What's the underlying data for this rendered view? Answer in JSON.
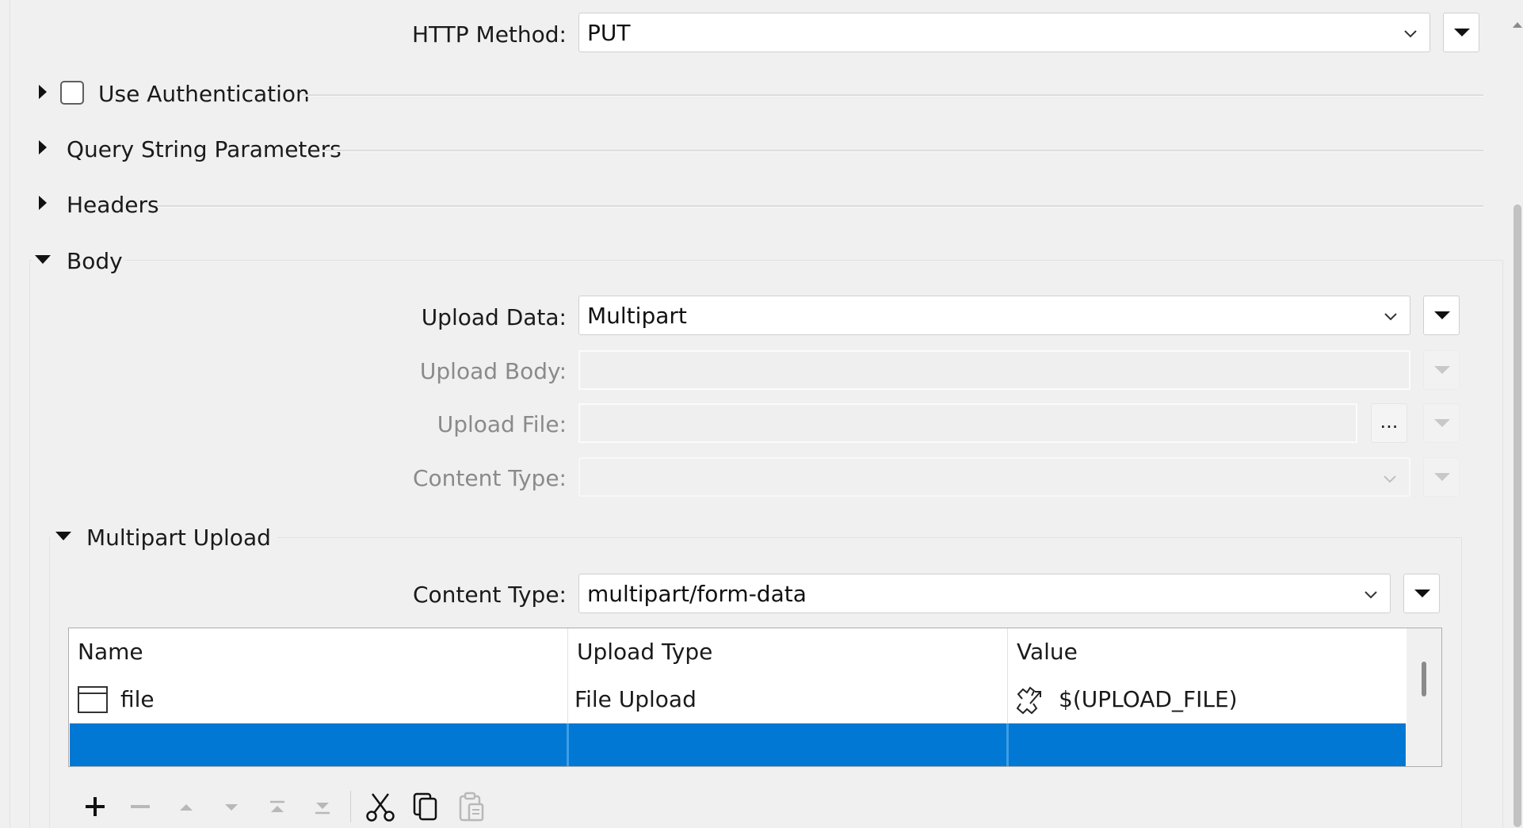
{
  "http_method": {
    "label": "HTTP Method:",
    "value": "PUT"
  },
  "sections": {
    "use_authentication": {
      "label": "Use Authentication",
      "checked": false
    },
    "query_string": {
      "label": "Query String Parameters"
    },
    "headers": {
      "label": "Headers"
    },
    "body": {
      "label": "Body"
    }
  },
  "body": {
    "upload_data": {
      "label": "Upload Data:",
      "value": "Multipart"
    },
    "upload_body": {
      "label": "Upload Body:",
      "value": ""
    },
    "upload_file": {
      "label": "Upload File:",
      "value": "",
      "browse_label": "..."
    },
    "content_type": {
      "label": "Content Type:",
      "value": ""
    }
  },
  "multipart": {
    "title": "Multipart Upload",
    "content_type": {
      "label": "Content Type:",
      "value": "multipart/form-data"
    },
    "table": {
      "columns": [
        "Name",
        "Upload Type",
        "Value"
      ],
      "rows": [
        {
          "name": "file",
          "upload_type": "File Upload",
          "value": "$(UPLOAD_FILE)"
        }
      ]
    }
  },
  "toolbar": {
    "icons": [
      "add-icon",
      "remove-icon",
      "move-up-icon",
      "move-down-icon",
      "move-top-icon",
      "move-bottom-icon",
      "cut-icon",
      "copy-icon",
      "paste-icon"
    ]
  },
  "colors": {
    "selection": "#0078d4",
    "disabled_text": "#8a8a8a"
  }
}
